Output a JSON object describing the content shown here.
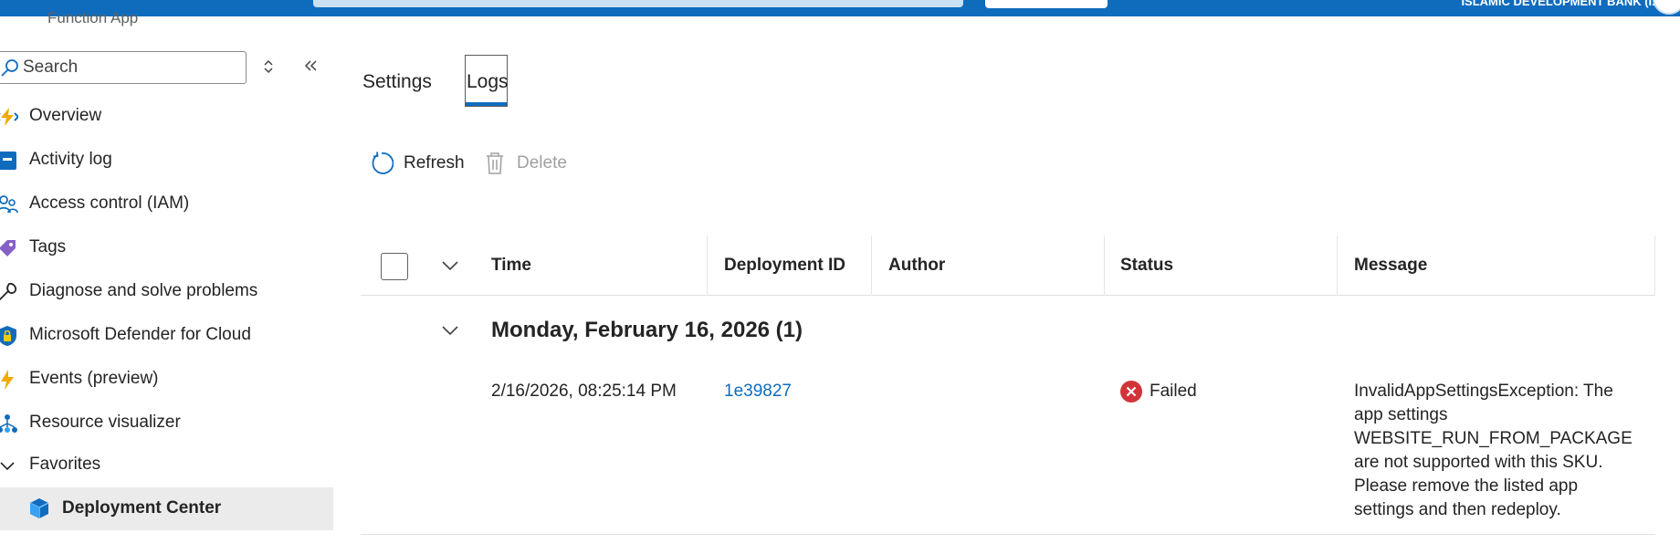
{
  "topbar": {
    "tenant": "ISLAMIC DEVELOPMENT BANK (I..."
  },
  "resource_type": "Function App",
  "sidebar": {
    "search_placeholder": "Search",
    "items": [
      {
        "label": "Overview",
        "icon": "function-bolt-icon"
      },
      {
        "label": "Activity log",
        "icon": "activity-log-icon"
      },
      {
        "label": "Access control (IAM)",
        "icon": "people-icon"
      },
      {
        "label": "Tags",
        "icon": "tag-icon"
      },
      {
        "label": "Diagnose and solve problems",
        "icon": "wrench-icon"
      },
      {
        "label": "Microsoft Defender for Cloud",
        "icon": "shield-lock-icon"
      },
      {
        "label": "Events (preview)",
        "icon": "lightning-icon"
      },
      {
        "label": "Resource visualizer",
        "icon": "hierarchy-icon"
      }
    ],
    "favorites_label": "Favorites",
    "selected_item": "Deployment Center"
  },
  "tabs": {
    "settings": "Settings",
    "logs": "Logs"
  },
  "toolbar": {
    "refresh": "Refresh",
    "delete": "Delete"
  },
  "grid": {
    "columns": {
      "time": "Time",
      "deployment_id": "Deployment ID",
      "author": "Author",
      "status": "Status",
      "message": "Message"
    },
    "group_title": "Monday, February 16, 2026 (1)",
    "rows": [
      {
        "time": "2/16/2026, 08:25:14 PM",
        "deployment_id": "1e39827",
        "author": "",
        "status": "Failed",
        "message": "InvalidAppSettingsException: The app settings WEBSITE_RUN_FROM_PACKAGE are not supported with this SKU. Please remove the listed app settings and then redeploy."
      }
    ]
  },
  "colors": {
    "accent": "#0f6cbd",
    "error": "#d13438",
    "selected_bg": "#ebebeb"
  }
}
